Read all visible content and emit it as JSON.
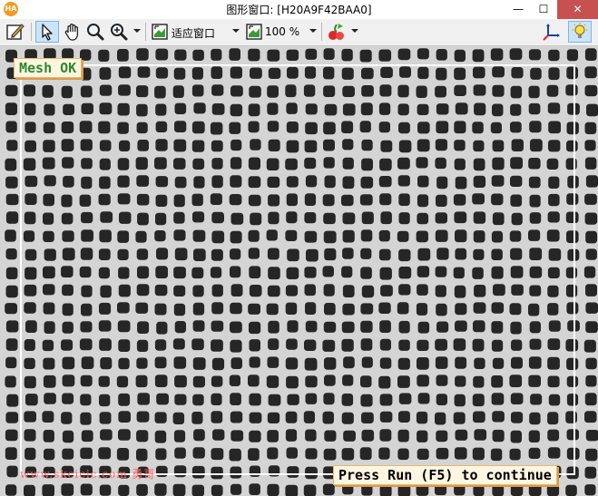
{
  "app": {
    "logo_text": "HA",
    "title": "图形窗口: [H20A9F42BAA0]"
  },
  "window_controls": {
    "minimize": "—",
    "maximize": "☐",
    "close": "✕"
  },
  "toolbar": {
    "fit_window_label": "适应窗口",
    "zoom_label": "100 %",
    "icons": [
      "edit-icon",
      "pointer-icon",
      "hand-pan-icon",
      "zoom-icon",
      "zoom-in-icon",
      "fit-window-icon",
      "zoom-level-icon",
      "color-icon",
      "axes-icon",
      "lightbulb-icon"
    ],
    "selected_tool": "pointer-icon"
  },
  "canvas": {
    "status_label": "Mesh OK",
    "prompt_label": "Press Run (F5) to continue",
    "watermark": "www.skcicic.com 勇哥",
    "colors": {
      "status_green": "#2c8a2c",
      "label_bg": "#fff6e2",
      "roi_outline": "#ffffff",
      "mesh_hole": "#262626",
      "mesh_thread": "#d4d4d4"
    }
  }
}
